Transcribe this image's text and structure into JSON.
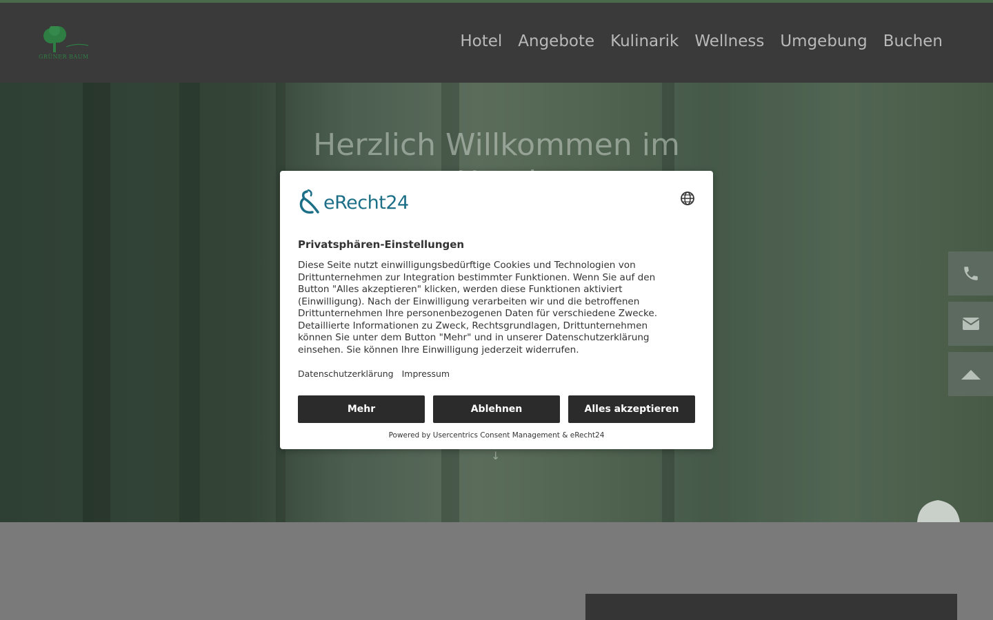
{
  "header": {
    "logo_text": "GRÜNER BAUM",
    "nav": [
      "Hotel",
      "Angebote",
      "Kulinarik",
      "Wellness",
      "Umgebung",
      "Buchen"
    ]
  },
  "hero": {
    "title_line1": "Herzlich Willkommen im",
    "title_line2": "Hotel"
  },
  "side_buttons": [
    "phone-icon",
    "envelope-icon",
    "arrow-up-icon"
  ],
  "consent": {
    "brand": "eRecht24",
    "title": "Privatsphären-Einstellungen",
    "body": "Diese Seite nutzt einwilligungsbedürftige Cookies und Technologien von Drittunternehmen zur Integration bestimmter Funktionen. Wenn Sie auf den Button \"Alles akzeptieren\" klicken, werden diese Funktionen aktiviert (Einwilligung). Nach der Einwilligung verarbeiten wir und die betroffenen Drittunternehmen Ihre personenbezogenen Daten für verschiedene Zwecke. Detaillierte Informationen zu Zweck, Rechtsgrundlagen, Drittunternehmen können Sie unter dem Button \"Mehr\" und in unserer Datenschutzerklärung einsehen. Sie können Ihre Einwilligung jederzeit widerrufen.",
    "link_privacy": "Datenschutzerklärung",
    "link_imprint": "Impressum",
    "btn_more": "Mehr",
    "btn_decline": "Ablehnen",
    "btn_accept": "Alles akzeptieren",
    "powered": "Powered by Usercentrics Consent Management & eRecht24"
  },
  "colors": {
    "header_bg": "#3a3a3a",
    "brand_teal": "#1c6f86",
    "button_bg": "#2b2b2b",
    "logo_green": "#2e7d43"
  }
}
